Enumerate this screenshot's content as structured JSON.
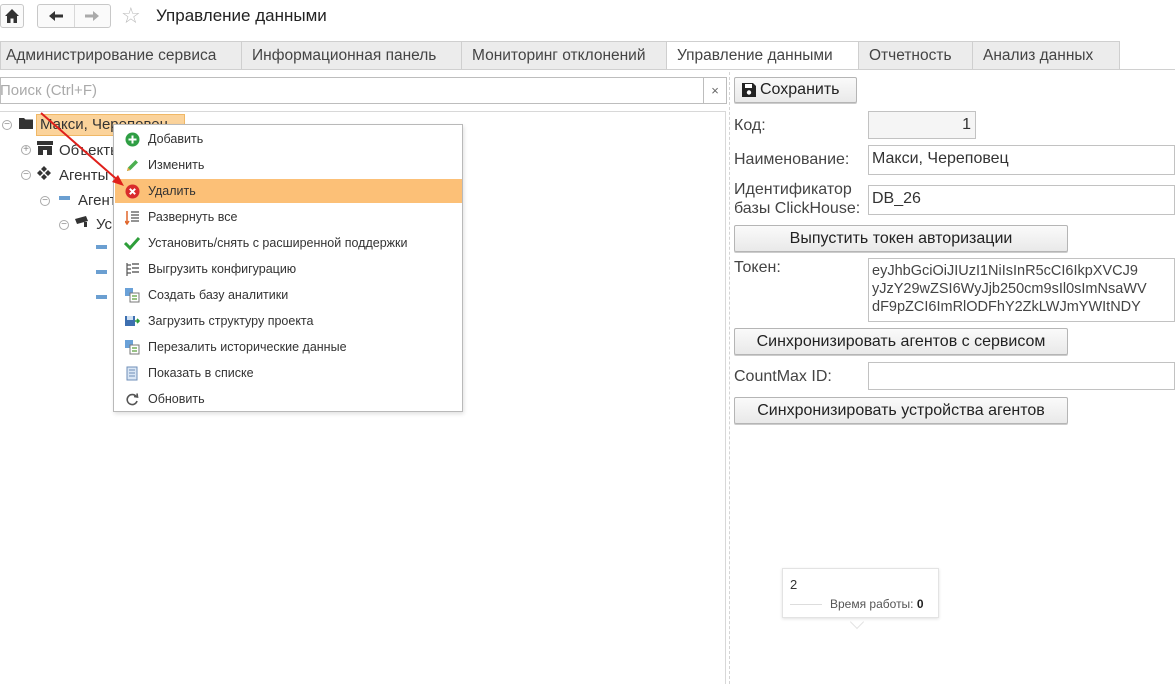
{
  "header": {
    "title": "Управление данными"
  },
  "tabs": [
    {
      "label": "Администрирование сервиса"
    },
    {
      "label": "Информационная панель"
    },
    {
      "label": "Мониторинг отклонений"
    },
    {
      "label": "Управление данными"
    },
    {
      "label": "Отчетность"
    },
    {
      "label": "Анализ данных"
    }
  ],
  "search": {
    "placeholder": "Поиск (Ctrl+F)",
    "clear": "×"
  },
  "tree": {
    "root": "Макси, Череповец",
    "objects": "Объекты",
    "agents": "Агенты",
    "agent": "Агент",
    "devices": "Ус"
  },
  "context_menu": {
    "items": [
      {
        "label": "Добавить",
        "icon": "add-icon"
      },
      {
        "label": "Изменить",
        "icon": "pencil-icon"
      },
      {
        "label": "Удалить",
        "icon": "delete-icon"
      },
      {
        "label": "Развернуть все",
        "icon": "expand-all-icon"
      },
      {
        "label": "Установить/снять с расширенной поддержки",
        "icon": "check-icon"
      },
      {
        "label": "Выгрузить конфигурацию",
        "icon": "export-config-icon"
      },
      {
        "label": "Создать базу аналитики",
        "icon": "create-db-icon"
      },
      {
        "label": "Загрузить структуру проекта",
        "icon": "load-structure-icon"
      },
      {
        "label": "Перезалить исторические данные",
        "icon": "reload-data-icon"
      },
      {
        "label": "Показать в списке",
        "icon": "list-icon"
      },
      {
        "label": "Обновить",
        "icon": "refresh-icon"
      }
    ]
  },
  "form": {
    "save_label": "Сохранить",
    "code_label": "Код:",
    "code_value": "1",
    "name_label": "Наименование:",
    "name_value": "Макси, Череповец",
    "id_label_1": "Идентификатор",
    "id_label_2": "базы ClickHouse:",
    "id_value": "DB_26",
    "issue_token_label": "Выпустить токен авторизации",
    "token_label": "Токен:",
    "token_lines": [
      "eyJhbGciOiJIUzI1NiIsInR5cCI6IkpXVCJ9",
      "yJzY29wZSI6WyJjb250cm9sIl0sImNsaWV",
      "dF9pZCI6ImRlODFhY2ZkLWJmYWItNDY"
    ],
    "sync_agents_label": "Синхронизировать агентов с сервисом",
    "countmax_label": "CountMax ID:",
    "countmax_value": "",
    "sync_devices_label": "Синхронизировать устройства агентов"
  },
  "tooltip": {
    "value": "2",
    "series_label": "Время работы:",
    "series_value": "0"
  },
  "colors": {
    "highlight": "#fcc077",
    "selection": "#fbd39b",
    "arrow": "#e0201b"
  }
}
